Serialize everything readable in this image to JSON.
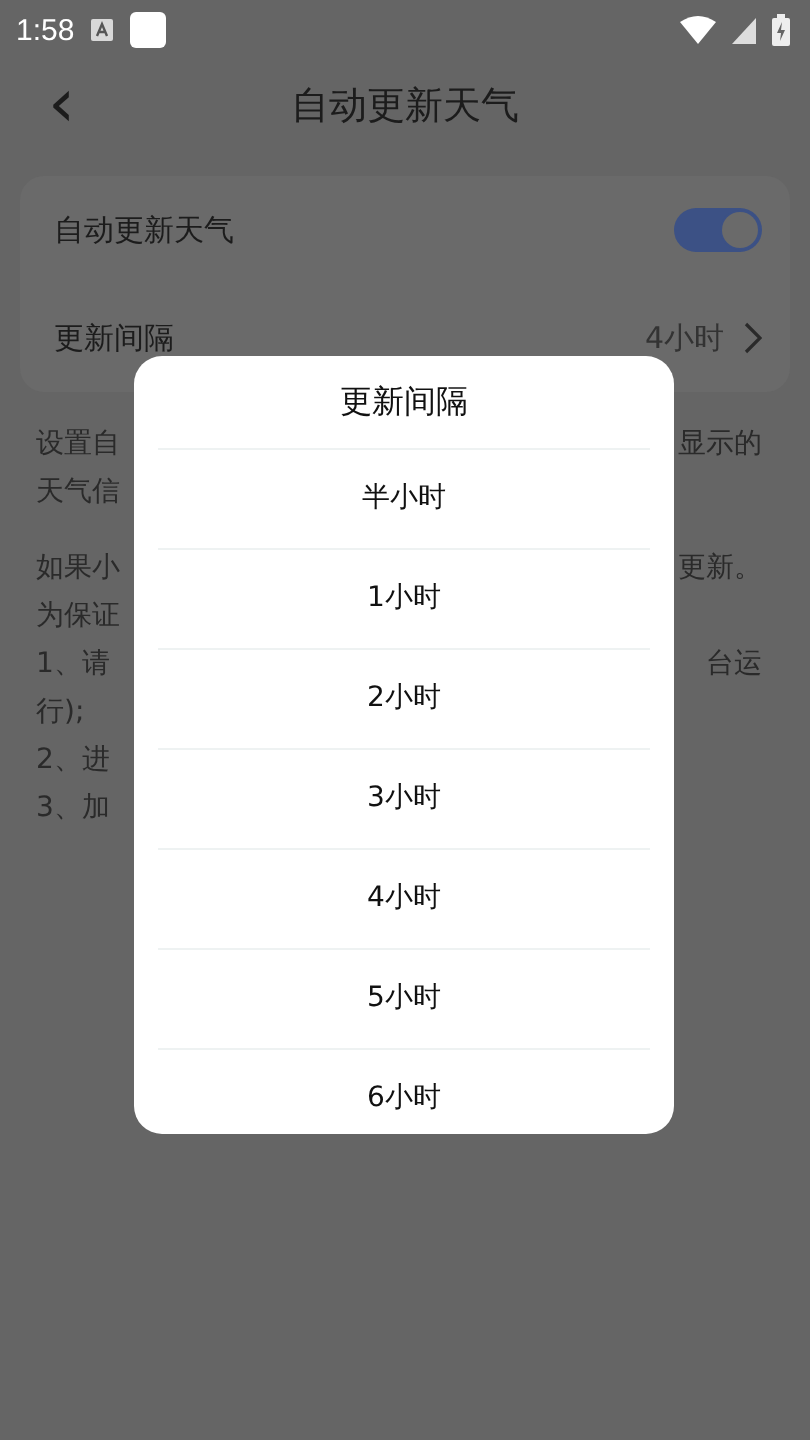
{
  "status_bar": {
    "time": "1:58"
  },
  "header": {
    "back_glyph": "‹",
    "title": "自动更新天气"
  },
  "settings": [
    {
      "kind": "toggle",
      "label": "自动更新天气",
      "on": true
    },
    {
      "kind": "value",
      "label": "更新间隔",
      "value": "4小时"
    }
  ],
  "description_paragraphs": [
    [
      {
        "left": "设置自",
        "right": "显示的"
      },
      {
        "left": "天气信"
      }
    ],
    [
      {
        "left": "如果小",
        "right": "更新。"
      },
      {
        "left": "为保证"
      },
      {
        "left": "1、请",
        "right": "台运"
      },
      {
        "left": "行);"
      },
      {
        "left": "2、进"
      },
      {
        "left": "3、加"
      }
    ]
  ],
  "dialog": {
    "title": "更新间隔",
    "options": [
      {
        "label": "半小时"
      },
      {
        "label": "1小时"
      },
      {
        "label": "2小时"
      },
      {
        "label": "3小时"
      },
      {
        "label": "4小时"
      },
      {
        "label": "5小时"
      },
      {
        "label": "6小时"
      }
    ]
  }
}
